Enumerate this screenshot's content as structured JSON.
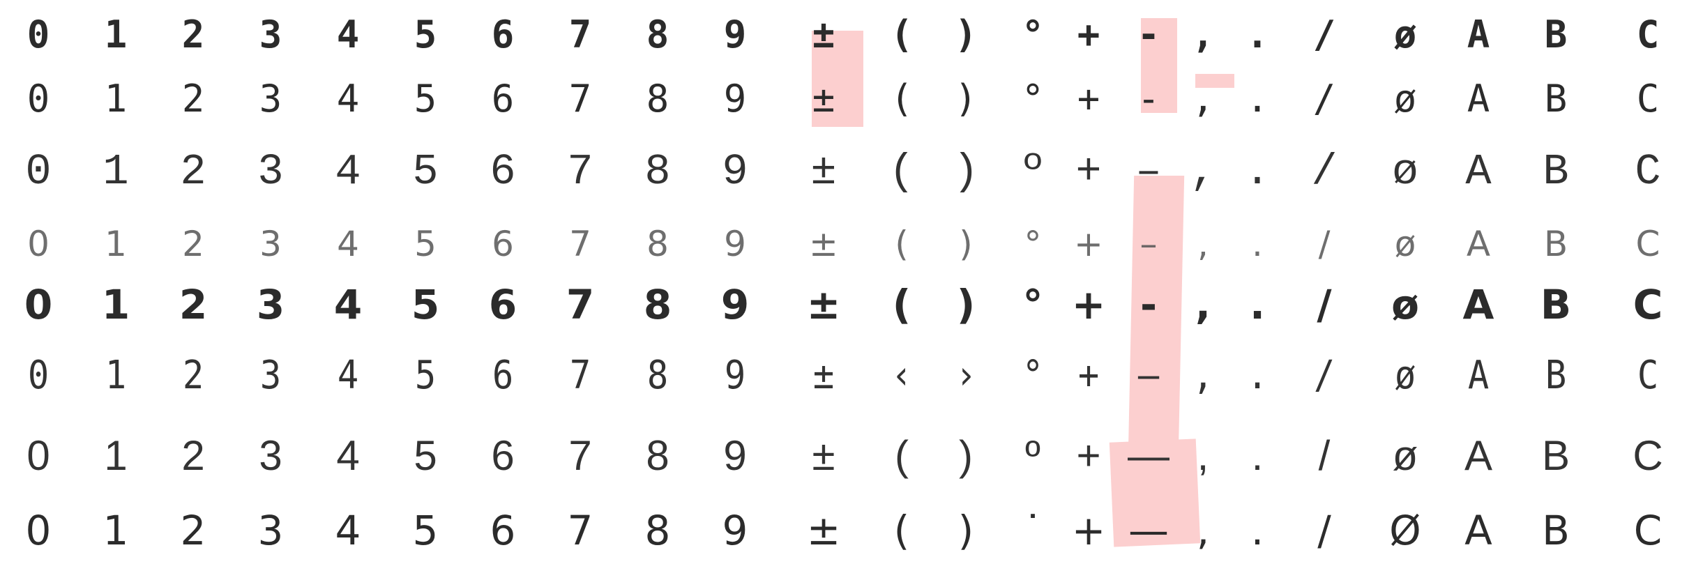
{
  "glyph_rows": [
    [
      "0",
      "1",
      "2",
      "3",
      "4",
      "5",
      "6",
      "7",
      "8",
      "9",
      "±",
      "(",
      ")",
      "°",
      "+",
      "-",
      ",",
      ".",
      "/",
      "ø",
      "A",
      "B",
      "C"
    ],
    [
      "0",
      "1",
      "2",
      "3",
      "4",
      "5",
      "6",
      "7",
      "8",
      "9",
      "±",
      "(",
      ")",
      "°",
      "+",
      "-",
      ",",
      ".",
      "/",
      "ø",
      "A",
      "B",
      "C"
    ],
    [
      "0",
      "1",
      "2",
      "3",
      "4",
      "5",
      "6",
      "7",
      "8",
      "9",
      "±",
      "(",
      ")",
      "º",
      "+",
      "–",
      ",",
      ".",
      "/",
      "ø",
      "A",
      "B",
      "C"
    ],
    [
      "0",
      "1",
      "2",
      "3",
      "4",
      "5",
      "6",
      "7",
      "8",
      "9",
      "±",
      "(",
      ")",
      "°",
      "+",
      "–",
      ",",
      ".",
      "/",
      "ø",
      "A",
      "B",
      "C"
    ],
    [
      "0",
      "1",
      "2",
      "3",
      "4",
      "5",
      "6",
      "7",
      "8",
      "9",
      "±",
      "(",
      ")",
      "°",
      "+",
      "-",
      ",",
      ".",
      "/",
      "ø",
      "A",
      "B",
      "C"
    ],
    [
      "0",
      "1",
      "2",
      "3",
      "4",
      "5",
      "6",
      "7",
      "8",
      "9",
      "±",
      "‹",
      "›",
      "°",
      "+",
      "–",
      ",",
      ".",
      "/",
      "ø",
      "A",
      "B",
      "C"
    ],
    [
      "0",
      "1",
      "2",
      "3",
      "4",
      "5",
      "6",
      "7",
      "8",
      "9",
      "±",
      "(",
      ")",
      "º",
      "+",
      "—",
      ",",
      ".",
      "/",
      "ø",
      "A",
      "B",
      "C"
    ],
    [
      "0",
      "1",
      "2",
      "3",
      "4",
      "5",
      "6",
      "7",
      "8",
      "9",
      "±",
      "(",
      ")",
      "˙",
      "+",
      "—",
      ",",
      ".",
      "/",
      "Ø",
      "A",
      "B",
      "C"
    ]
  ],
  "highlight_color": "#fccfcf"
}
